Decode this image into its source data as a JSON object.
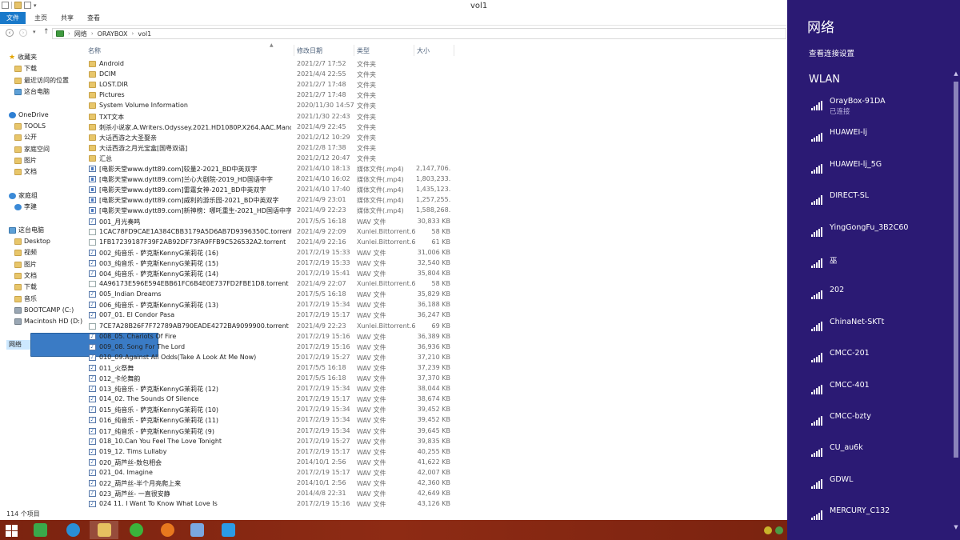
{
  "window": {
    "title": "vol1",
    "ribbon_tabs": [
      "文件",
      "主页",
      "共享",
      "查看"
    ]
  },
  "address": {
    "crumbs": [
      "网络",
      "ORAYBOX",
      "vol1"
    ]
  },
  "nav": {
    "items": [
      {
        "label": "收藏夹",
        "icon": "star-icon",
        "level": 0
      },
      {
        "label": "下载",
        "icon": "folder-icon",
        "level": 1
      },
      {
        "label": "最近访问的位置",
        "icon": "folder-icon",
        "level": 1
      },
      {
        "label": "这台电脑",
        "icon": "pc-icon",
        "level": 1
      },
      {
        "label": "OneDrive",
        "icon": "cloud-icon",
        "level": 0
      },
      {
        "label": "TOOLS",
        "icon": "folder-icon",
        "level": 1
      },
      {
        "label": "公开",
        "icon": "folder-icon",
        "level": 1
      },
      {
        "label": "家庭空间",
        "icon": "folder-icon",
        "level": 1
      },
      {
        "label": "图片",
        "icon": "folder-icon",
        "level": 1
      },
      {
        "label": "文档",
        "icon": "folder-icon",
        "level": 1
      },
      {
        "label": "家庭组",
        "icon": "group-icon",
        "level": 0
      },
      {
        "label": "李建",
        "icon": "user-icon",
        "level": 1
      },
      {
        "label": "这台电脑",
        "icon": "pc-icon",
        "level": 0
      },
      {
        "label": "Desktop",
        "icon": "folder-icon",
        "level": 1
      },
      {
        "label": "视频",
        "icon": "folder-icon",
        "level": 1
      },
      {
        "label": "图片",
        "icon": "folder-icon",
        "level": 1
      },
      {
        "label": "文档",
        "icon": "folder-icon",
        "level": 1
      },
      {
        "label": "下载",
        "icon": "folder-icon",
        "level": 1
      },
      {
        "label": "音乐",
        "icon": "folder-icon",
        "level": 1
      },
      {
        "label": "BOOTCAMP (C:)",
        "icon": "drive-icon",
        "level": 1
      },
      {
        "label": "Macintosh HD (D:)",
        "icon": "drive-icon",
        "level": 1
      },
      {
        "label": "网络",
        "icon": "network-icon",
        "level": 0,
        "selected": true
      }
    ]
  },
  "columns": {
    "name": "名称",
    "date": "修改日期",
    "type": "类型",
    "size": "大小"
  },
  "files": [
    {
      "name": "Android",
      "date": "2021/2/7 17:52",
      "type": "文件夹",
      "size": "",
      "icon": "folder"
    },
    {
      "name": "DCIM",
      "date": "2021/4/4 22:55",
      "type": "文件夹",
      "size": "",
      "icon": "folder"
    },
    {
      "name": "LOST.DIR",
      "date": "2021/2/7 17:48",
      "type": "文件夹",
      "size": "",
      "icon": "folder"
    },
    {
      "name": "Pictures",
      "date": "2021/2/7 17:48",
      "type": "文件夹",
      "size": "",
      "icon": "folder"
    },
    {
      "name": "System Volume Information",
      "date": "2020/11/30 14:57",
      "type": "文件夹",
      "size": "",
      "icon": "folder"
    },
    {
      "name": "TXT文本",
      "date": "2021/1/30 22:43",
      "type": "文件夹",
      "size": "",
      "icon": "folder"
    },
    {
      "name": "刺杀小说家.A.Writers.Odyssey.2021.HD1080P.X264.AAC.Mandarin...",
      "date": "2021/4/9 22:45",
      "type": "文件夹",
      "size": "",
      "icon": "folder"
    },
    {
      "name": "大话西游之大圣娶亲",
      "date": "2021/2/12 10:29",
      "type": "文件夹",
      "size": "",
      "icon": "folder"
    },
    {
      "name": "大话西游之月光宝盒[国粤双语]",
      "date": "2021/2/8 17:38",
      "type": "文件夹",
      "size": "",
      "icon": "folder"
    },
    {
      "name": "汇总",
      "date": "2021/2/12 20:47",
      "type": "文件夹",
      "size": "",
      "icon": "folder"
    },
    {
      "name": "[电影天堂www.dytt89.com]较量2-2021_BD中英双字",
      "date": "2021/4/10 18:13",
      "type": "媒体文件(.mp4)",
      "size": "2,147,706...",
      "icon": "video"
    },
    {
      "name": "[电影天堂www.dytt89.com]兰心大剧院-2019_HD国语中字",
      "date": "2021/4/10 16:02",
      "type": "媒体文件(.mp4)",
      "size": "1,803,233...",
      "icon": "video"
    },
    {
      "name": "[电影天堂www.dytt89.com]雷霆女神-2021_BD中英双字",
      "date": "2021/4/10 17:40",
      "type": "媒体文件(.mp4)",
      "size": "1,435,123...",
      "icon": "video"
    },
    {
      "name": "[电影天堂www.dytt89.com]威利的游乐园-2021_BD中英双字",
      "date": "2021/4/9 23:01",
      "type": "媒体文件(.mp4)",
      "size": "1,257,255...",
      "icon": "video"
    },
    {
      "name": "[电影天堂www.dytt89.com]新神榜：哪吒重生-2021_HD国语中字",
      "date": "2021/4/9 22:23",
      "type": "媒体文件(.mp4)",
      "size": "1,588,268...",
      "icon": "video"
    },
    {
      "name": "001_月光奏鸣",
      "date": "2017/5/5 16:18",
      "type": "WAV 文件",
      "size": "30,833 KB",
      "icon": "audio"
    },
    {
      "name": "1CAC78FD9CAE1A384CBB3179A5D6AB7D9396350C.torrent",
      "date": "2021/4/9 22:09",
      "type": "Xunlei.Bittorrent.6",
      "size": "58 KB",
      "icon": "file"
    },
    {
      "name": "1FB17239187F39F2AB92DF73FA9FFB9C526532A2.torrent",
      "date": "2021/4/9 22:16",
      "type": "Xunlei.Bittorrent.6",
      "size": "61 KB",
      "icon": "file"
    },
    {
      "name": "002_纯音乐 - 萨克斯KennyG茉莉花 (16)",
      "date": "2017/2/19 15:33",
      "type": "WAV 文件",
      "size": "31,006 KB",
      "icon": "audio"
    },
    {
      "name": "003_纯音乐 - 萨克斯KennyG茉莉花 (15)",
      "date": "2017/2/19 15:33",
      "type": "WAV 文件",
      "size": "32,540 KB",
      "icon": "audio"
    },
    {
      "name": "004_纯音乐 - 萨克斯KennyG茉莉花 (14)",
      "date": "2017/2/19 15:41",
      "type": "WAV 文件",
      "size": "35,804 KB",
      "icon": "audio"
    },
    {
      "name": "4A96173E596E594EBB61FC6B4E0E737FD2FBE1D8.torrent",
      "date": "2021/4/9 22:07",
      "type": "Xunlei.Bittorrent.6",
      "size": "58 KB",
      "icon": "file"
    },
    {
      "name": "005_Indian Dreams",
      "date": "2017/5/5 16:18",
      "type": "WAV 文件",
      "size": "35,829 KB",
      "icon": "audio"
    },
    {
      "name": "006_纯音乐 - 萨克斯KennyG茉莉花 (13)",
      "date": "2017/2/19 15:34",
      "type": "WAV 文件",
      "size": "36,188 KB",
      "icon": "audio"
    },
    {
      "name": "007_01. El Condor Pasa",
      "date": "2017/2/19 15:17",
      "type": "WAV 文件",
      "size": "36,247 KB",
      "icon": "audio"
    },
    {
      "name": "7CE7A28B26F7F72789AB790EADE4272BA9099900.torrent",
      "date": "2021/4/9 22:23",
      "type": "Xunlei.Bittorrent.6",
      "size": "69 KB",
      "icon": "file"
    },
    {
      "name": "008_05. Chariots Of Fire",
      "date": "2017/2/19 15:16",
      "type": "WAV 文件",
      "size": "36,389 KB",
      "icon": "audio"
    },
    {
      "name": "009_08. Song For The Lord",
      "date": "2017/2/19 15:16",
      "type": "WAV 文件",
      "size": "36,936 KB",
      "icon": "audio"
    },
    {
      "name": "010_09.Against All Odds(Take A Look At Me Now)",
      "date": "2017/2/19 15:27",
      "type": "WAV 文件",
      "size": "37,210 KB",
      "icon": "audio"
    },
    {
      "name": "011_火祭舞",
      "date": "2017/5/5 16:18",
      "type": "WAV 文件",
      "size": "37,239 KB",
      "icon": "audio"
    },
    {
      "name": "012_卡伦舞韵",
      "date": "2017/5/5 16:18",
      "type": "WAV 文件",
      "size": "37,370 KB",
      "icon": "audio"
    },
    {
      "name": "013_纯音乐 - 萨克斯KennyG茉莉花 (12)",
      "date": "2017/2/19 15:34",
      "type": "WAV 文件",
      "size": "38,044 KB",
      "icon": "audio"
    },
    {
      "name": "014_02. The Sounds Of Silence",
      "date": "2017/2/19 15:17",
      "type": "WAV 文件",
      "size": "38,674 KB",
      "icon": "audio"
    },
    {
      "name": "015_纯音乐 - 萨克斯KennyG茉莉花 (10)",
      "date": "2017/2/19 15:34",
      "type": "WAV 文件",
      "size": "39,452 KB",
      "icon": "audio"
    },
    {
      "name": "016_纯音乐 - 萨克斯KennyG茉莉花 (11)",
      "date": "2017/2/19 15:34",
      "type": "WAV 文件",
      "size": "39,452 KB",
      "icon": "audio"
    },
    {
      "name": "017_纯音乐 - 萨克斯KennyG茉莉花 (9)",
      "date": "2017/2/19 15:34",
      "type": "WAV 文件",
      "size": "39,645 KB",
      "icon": "audio"
    },
    {
      "name": "018_10.Can You Feel The Love Tonight",
      "date": "2017/2/19 15:27",
      "type": "WAV 文件",
      "size": "39,835 KB",
      "icon": "audio"
    },
    {
      "name": "019_12. Tims Lullaby",
      "date": "2017/2/19 15:17",
      "type": "WAV 文件",
      "size": "40,255 KB",
      "icon": "audio"
    },
    {
      "name": "020_葫芦丝-敖包相会",
      "date": "2014/10/1 2:56",
      "type": "WAV 文件",
      "size": "41,622 KB",
      "icon": "audio"
    },
    {
      "name": "021_04. Imagine",
      "date": "2017/2/19 15:17",
      "type": "WAV 文件",
      "size": "42,007 KB",
      "icon": "audio"
    },
    {
      "name": "022_葫芦丝-半个月亮爬上来",
      "date": "2014/10/1 2:56",
      "type": "WAV 文件",
      "size": "42,360 KB",
      "icon": "audio"
    },
    {
      "name": "023_葫芦丝- 一直很安静",
      "date": "2014/4/8 22:31",
      "type": "WAV 文件",
      "size": "42,649 KB",
      "icon": "audio"
    },
    {
      "name": "024 11. I Want To Know What Love Is",
      "date": "2017/2/19 15:16",
      "type": "WAV 文件",
      "size": "43,126 KB",
      "icon": "audio"
    }
  ],
  "status": {
    "count": "114 个项目"
  },
  "flyout": {
    "title": "网络",
    "settings_link": "查看连接设置",
    "section": "WLAN",
    "networks": [
      {
        "name": "OrayBox-91DA",
        "status": "已连接",
        "strength": 5
      },
      {
        "name": "HUAWEI-lj",
        "status": "",
        "strength": 5
      },
      {
        "name": "HUAWEI-lj_5G",
        "status": "",
        "strength": 5
      },
      {
        "name": "DIRECT-SL",
        "status": "",
        "strength": 5
      },
      {
        "name": "YingGongFu_3B2C60",
        "status": "",
        "strength": 5
      },
      {
        "name": "巫",
        "status": "",
        "strength": 5
      },
      {
        "name": "202",
        "status": "",
        "strength": 5
      },
      {
        "name": "ChinaNet-SKTt",
        "status": "",
        "strength": 5
      },
      {
        "name": "CMCC-201",
        "status": "",
        "strength": 5
      },
      {
        "name": "CMCC-401",
        "status": "",
        "strength": 5
      },
      {
        "name": "CMCC-bzty",
        "status": "",
        "strength": 5
      },
      {
        "name": "CU_au6k",
        "status": "",
        "strength": 5
      },
      {
        "name": "GDWL",
        "status": "",
        "strength": 5
      },
      {
        "name": "MERCURY_C132",
        "status": "",
        "strength": 5
      }
    ]
  },
  "taskbar": {
    "apps": [
      {
        "name": "start-icon"
      },
      {
        "name": "pinwheel-app-icon",
        "color": "#3aa84a"
      },
      {
        "name": "browser-q-icon",
        "color": "#2a8fd6"
      },
      {
        "name": "file-explorer-icon",
        "color": "#e5c060",
        "active": true
      },
      {
        "name": "wechat-icon",
        "color": "#3bb33b"
      },
      {
        "name": "thunder-download-icon",
        "color": "#e8781e"
      },
      {
        "name": "paint-app-icon",
        "color": "#7aa7e0"
      },
      {
        "name": "internet-explorer-icon",
        "color": "#2b9be6"
      }
    ],
    "tray": [
      {
        "name": "tray-app-icon",
        "color": "#c9b32a"
      },
      {
        "name": "security-shield-icon",
        "color": "#4c9b45"
      }
    ]
  }
}
